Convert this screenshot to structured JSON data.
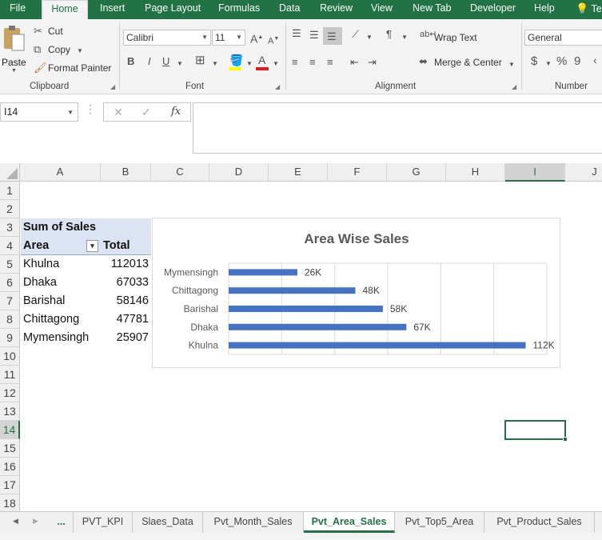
{
  "ribbon_tabs": [
    "File",
    "Home",
    "Insert",
    "Page Layout",
    "Formulas",
    "Data",
    "Review",
    "View",
    "New Tab",
    "Developer",
    "Help",
    "Tel"
  ],
  "active_tab": "Home",
  "clipboard": {
    "paste": "Paste",
    "cut": "Cut",
    "copy": "Copy",
    "format_painter": "Format Painter",
    "group": "Clipboard"
  },
  "font": {
    "name": "Calibri",
    "size": "11",
    "bold": "B",
    "italic": "I",
    "underline": "U",
    "group": "Font"
  },
  "alignment": {
    "wrap_text": "Wrap Text",
    "merge_center": "Merge & Center",
    "group": "Alignment"
  },
  "number": {
    "format": "General",
    "currency": "$",
    "percent": "%",
    "comma": "9",
    "group": "Number"
  },
  "formula_bar": {
    "name_box": "I14",
    "cancel": "✕",
    "enter": "✓",
    "fx": "fx",
    "content": ""
  },
  "columns": [
    "A",
    "B",
    "C",
    "D",
    "E",
    "F",
    "G",
    "H",
    "I",
    "J"
  ],
  "selected_column": "I",
  "rows": [
    "1",
    "2",
    "3",
    "4",
    "5",
    "6",
    "7",
    "8",
    "9",
    "10",
    "11",
    "12",
    "13",
    "14",
    "15",
    "16",
    "17",
    "18"
  ],
  "selected_row": "14",
  "pivot": {
    "title": "Sum of Sales",
    "header_area": "Area",
    "header_total": "Total",
    "filter_icon": "filter-dropdown-icon",
    "rows": [
      {
        "area": "Khulna",
        "total": "112013"
      },
      {
        "area": "Dhaka",
        "total": "67033"
      },
      {
        "area": "Barishal",
        "total": "58146"
      },
      {
        "area": "Chittagong",
        "total": "47781"
      },
      {
        "area": "Mymensingh",
        "total": "25907"
      }
    ]
  },
  "chart_data": {
    "type": "bar",
    "orientation": "horizontal",
    "title": "Area Wise Sales",
    "categories": [
      "Mymensingh",
      "Chittagong",
      "Barishal",
      "Dhaka",
      "Khulna"
    ],
    "values": [
      25907,
      47781,
      58146,
      67033,
      112013
    ],
    "data_labels": [
      "26K",
      "48K",
      "58K",
      "67K",
      "112K"
    ],
    "xlim": [
      0,
      120000
    ],
    "grid": true,
    "legend": "none",
    "bar_color": "#4472c4"
  },
  "sheet_tabs": [
    "...",
    "PVT_KPI",
    "Slaes_Data",
    "Pvt_Month_Sales",
    "Pvt_Area_Sales",
    "Pvt_Top5_Area",
    "Pvt_Product_Sales"
  ],
  "active_sheet": "Pvt_Area_Sales",
  "colors": {
    "excel_green": "#217346",
    "header_fill": "#dce3f2"
  }
}
